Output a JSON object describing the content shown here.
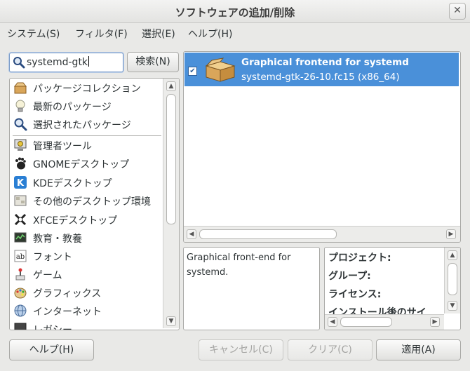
{
  "window": {
    "title": "ソフトウェアの追加/削除",
    "close_label": "✕"
  },
  "menubar": [
    "システム(S)",
    "フィルタ(F)",
    "選択(E)",
    "ヘルプ(H)"
  ],
  "search": {
    "value": "systemd-gtk",
    "button_label": "検索(N)"
  },
  "groups_top": [
    {
      "label": "パッケージコレクション",
      "icon": "package-collection-icon"
    },
    {
      "label": "最新のパッケージ",
      "icon": "lightbulb-icon"
    },
    {
      "label": "選択されたパッケージ",
      "icon": "search-icon"
    }
  ],
  "groups": [
    {
      "label": "管理者ツール",
      "icon": "admin-tools-icon"
    },
    {
      "label": "GNOMEデスクトップ",
      "icon": "gnome-foot-icon"
    },
    {
      "label": "KDEデスクトップ",
      "icon": "kde-icon"
    },
    {
      "label": "その他のデスクトップ環境",
      "icon": "desktop-icon"
    },
    {
      "label": "XFCEデスクトップ",
      "icon": "xfce-icon"
    },
    {
      "label": "教育・教養",
      "icon": "education-icon"
    },
    {
      "label": "フォント",
      "icon": "font-icon"
    },
    {
      "label": "ゲーム",
      "icon": "game-icon"
    },
    {
      "label": "グラフィックス",
      "icon": "graphics-palette-icon"
    },
    {
      "label": "インターネット",
      "icon": "globe-icon"
    },
    {
      "label": "レガシー",
      "icon": "legacy-icon"
    }
  ],
  "packages": [
    {
      "title": "Graphical frontend for systemd",
      "subtitle": "systemd-gtk-26-10.fc15 (x86_64)",
      "checked": true,
      "selected": true
    }
  ],
  "description": "Graphical front-end for systemd.",
  "details": [
    "プロジェクト:",
    "グループ:",
    "ライセンス:",
    "インストール後のサイ"
  ],
  "buttons": {
    "help": "ヘルプ(H)",
    "cancel": "キャンセル(C)",
    "clear": "クリア(C)",
    "apply": "適用(A)"
  },
  "colors": {
    "selection": "#4a90d9",
    "window_bg": "#e9e9e7"
  }
}
